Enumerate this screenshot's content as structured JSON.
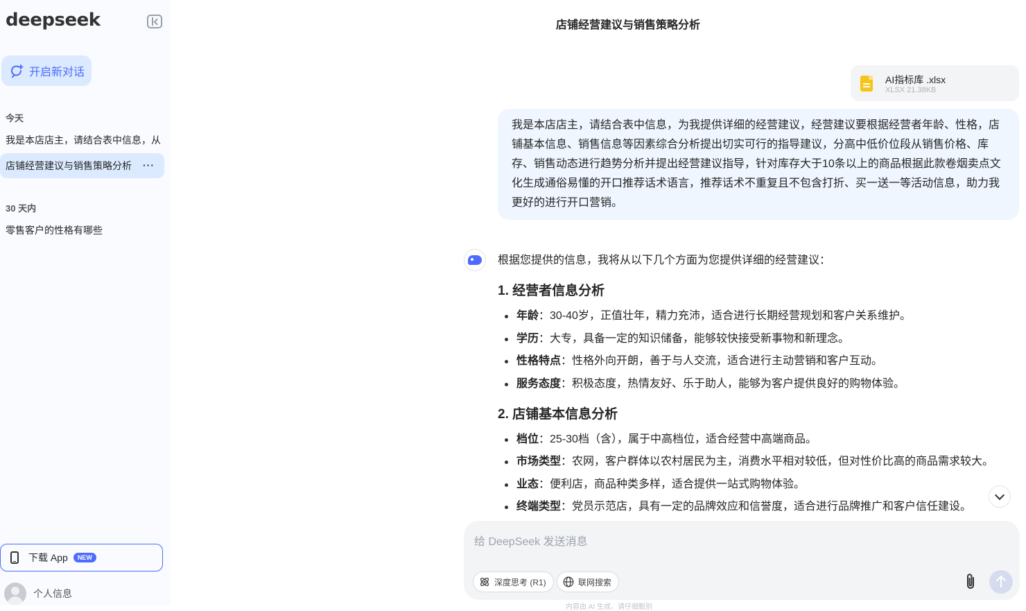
{
  "sidebar": {
    "logo": "deepseek",
    "new_chat_label": "开启新对话",
    "sections": [
      {
        "label": "今天",
        "items": [
          {
            "label": "我是本店店主，请结合表中信息，从",
            "active": false
          },
          {
            "label": "店铺经营建议与销售策略分析",
            "active": true
          }
        ]
      },
      {
        "label": "30 天内",
        "items": [
          {
            "label": "零售客户的性格有哪些",
            "active": false
          }
        ]
      }
    ],
    "more_label": "···",
    "download_label": "下载 App",
    "new_badge": "NEW",
    "profile_label": "个人信息"
  },
  "header": {
    "title": "店铺经营建议与销售策略分析"
  },
  "attachment": {
    "name": "AI指标库 .xlsx",
    "meta": "XLSX 21.38KB"
  },
  "user_message": "我是本店店主，请结合表中信息，为我提供详细的经营建议，经营建议要根据经营者年龄、性格，店铺基本信息、销售信息等因素综合分析提出切实可行的指导建议，分高中低价位段从销售价格、库存、销售动态进行趋势分析并提出经营建议指导，针对库存大于10条以上的商品根据此款卷烟卖点文化生成通俗易懂的开口推荐话术语言，推荐话术不重复且不包含打折、买一送一等活动信息，助力我更好的进行开口营销。",
  "answer": {
    "intro": "根据您提供的信息，我将从以下几个方面为您提供详细的经营建议：",
    "sections": [
      {
        "heading": "1. 经营者信息分析",
        "items": [
          {
            "term": "年龄",
            "text": "：30-40岁，正值壮年，精力充沛，适合进行长期经营规划和客户关系维护。"
          },
          {
            "term": "学历",
            "text": "：大专，具备一定的知识储备，能够较快接受新事物和新理念。"
          },
          {
            "term": "性格特点",
            "text": "：性格外向开朗，善于与人交流，适合进行主动营销和客户互动。"
          },
          {
            "term": "服务态度",
            "text": "：积极态度，热情友好、乐于助人，能够为客户提供良好的购物体验。"
          }
        ]
      },
      {
        "heading": "2. 店铺基本信息分析",
        "items": [
          {
            "term": "档位",
            "text": "：25-30档（含），属于中高档位，适合经营中高端商品。"
          },
          {
            "term": "市场类型",
            "text": "：农网，客户群体以农村居民为主，消费水平相对较低，但对性价比高的商品需求较大。"
          },
          {
            "term": "业态",
            "text": "：便利店，商品种类多样，适合提供一站式购物体验。"
          },
          {
            "term": "终端类型",
            "text": "：党员示范店，具有一定的品牌效应和信誉度，适合进行品牌推广和客户信任建设。"
          }
        ]
      }
    ]
  },
  "composer": {
    "placeholder": "给 DeepSeek 发送消息",
    "deep_think_label": "深度思考 (R1)",
    "web_search_label": "联网搜索"
  },
  "footnote": "内容由 AI 生成，请仔细甄别",
  "colors": {
    "accent": "#4d6bfe",
    "sidebar_bg": "#f9fbff",
    "bubble_bg": "#eff6ff"
  }
}
